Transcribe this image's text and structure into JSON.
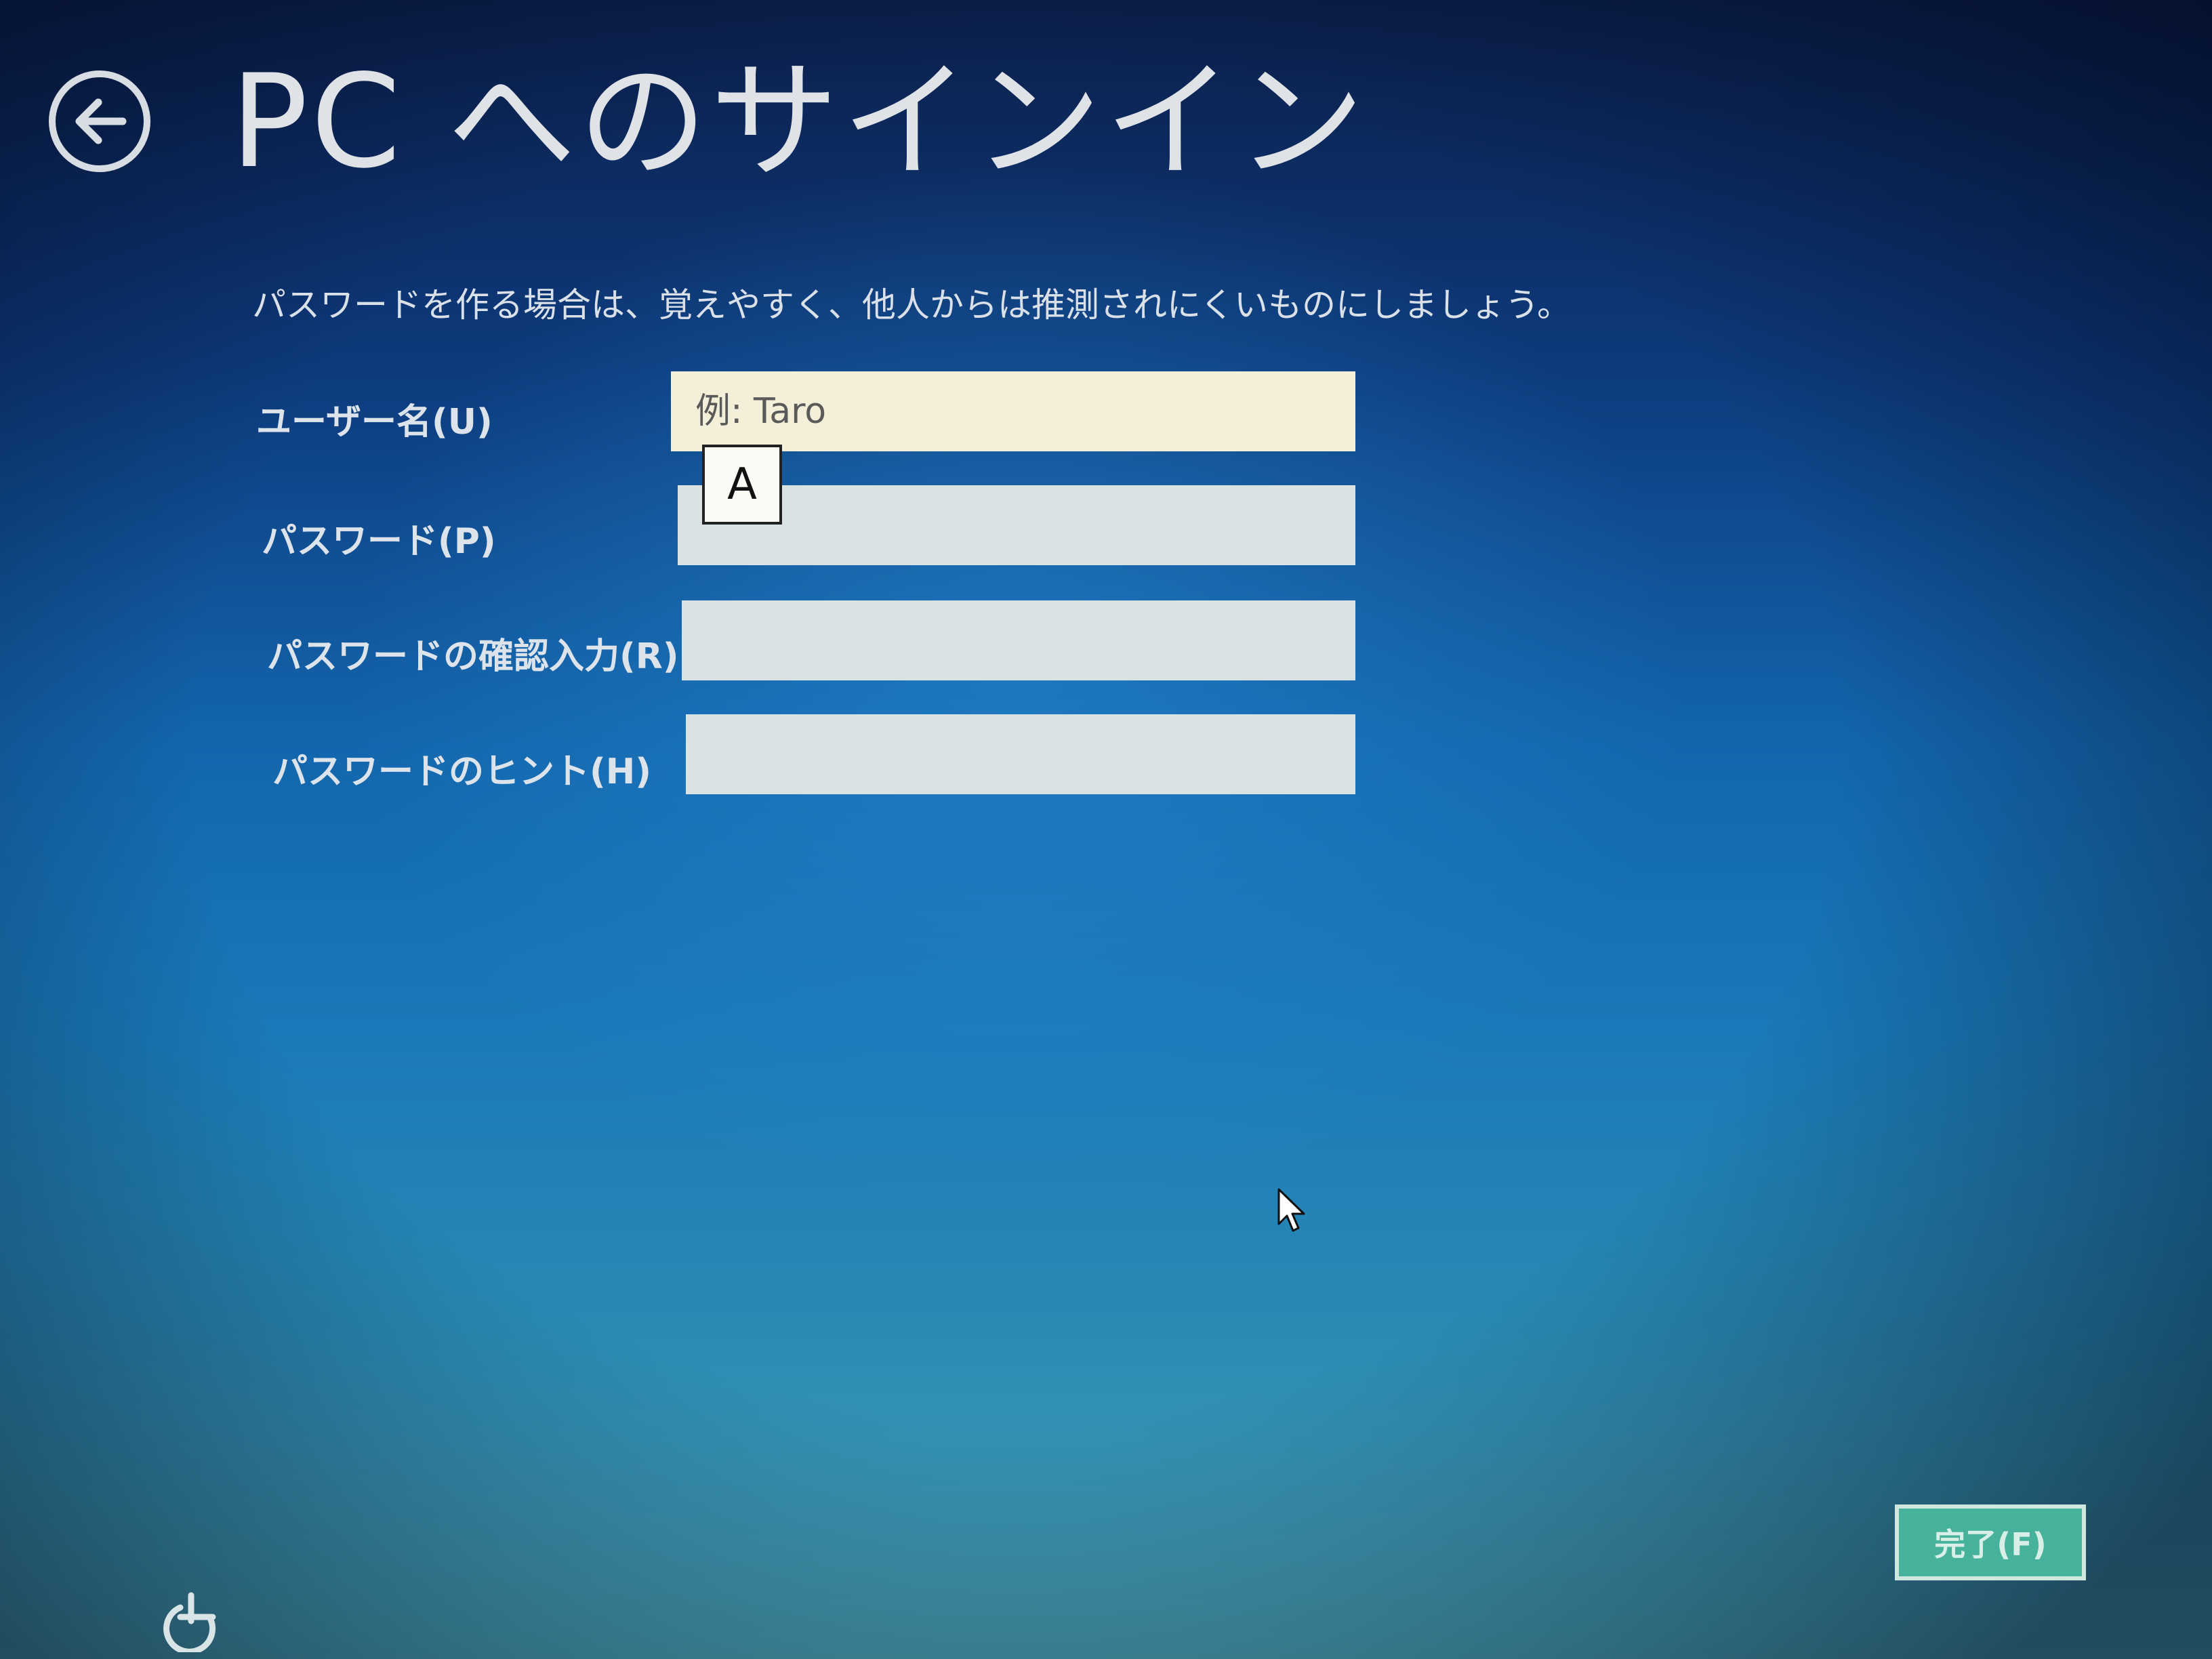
{
  "header": {
    "back_icon": "back-arrow-icon",
    "title": "PC へのサインイン"
  },
  "instructions": "パスワードを作る場合は、覚えやすく、他人からは推測されにくいものにしましょう。",
  "form": {
    "username": {
      "label": "ユーザー名(U)",
      "value": "",
      "placeholder": "例: Taro"
    },
    "password": {
      "label": "パスワード(P)",
      "value": ""
    },
    "password_confirm": {
      "label": "パスワードの確認入力(R)",
      "value": ""
    },
    "password_hint": {
      "label": "パスワードのヒント(H)",
      "value": ""
    }
  },
  "ime_indicator": "A",
  "finish_button": "完了(F)",
  "footer": {
    "ease_icon": "ease-of-access-icon"
  },
  "colors": {
    "title_text": "#dfe3e8",
    "focused_field": "#f3efd9",
    "field": "#d9e3e3",
    "finish_button": "#47b29b"
  }
}
